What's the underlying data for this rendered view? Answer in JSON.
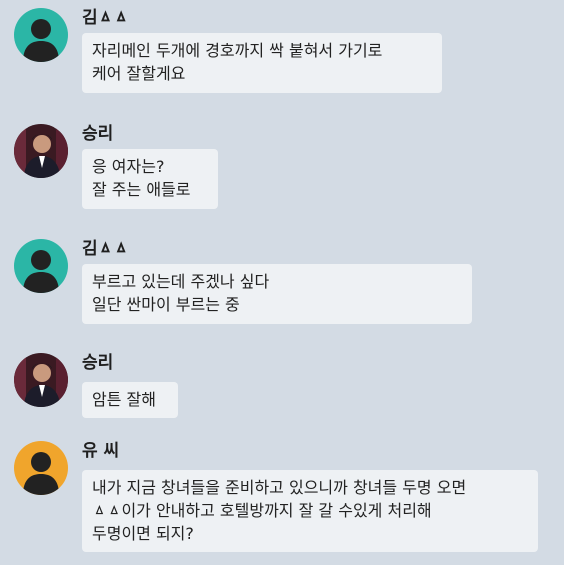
{
  "messages": [
    {
      "sender": "김ㅿㅿ",
      "avatar": "silhouette-teal",
      "avatar_color": "#2bb6a6",
      "lines": [
        "자리메인 두개에 경호까지 싹 붙혀서 가기로",
        "케어 잘할게요"
      ]
    },
    {
      "sender": "승리",
      "avatar": "photo-man-suit",
      "lines": [
        "응 여자는?",
        "잘 주는 애들로"
      ]
    },
    {
      "sender": "김ㅿㅿ",
      "avatar": "silhouette-teal",
      "avatar_color": "#2bb6a6",
      "lines": [
        "부르고 있는데 주겠나 싶다",
        "일단 싼마이 부르는 중"
      ]
    },
    {
      "sender": "승리",
      "avatar": "photo-man-suit",
      "lines": [
        "암튼 잘해"
      ]
    },
    {
      "sender": "유 씨",
      "avatar": "silhouette-orange",
      "avatar_color": "#f0a52c",
      "lines": [
        "내가 지금 창녀들을 준비하고 있으니까 창녀들 두명 오면",
        "ㅿㅿ이가 안내하고 호텔방까지 잘 갈 수있게 처리해",
        "두명이면 되지?"
      ]
    }
  ]
}
